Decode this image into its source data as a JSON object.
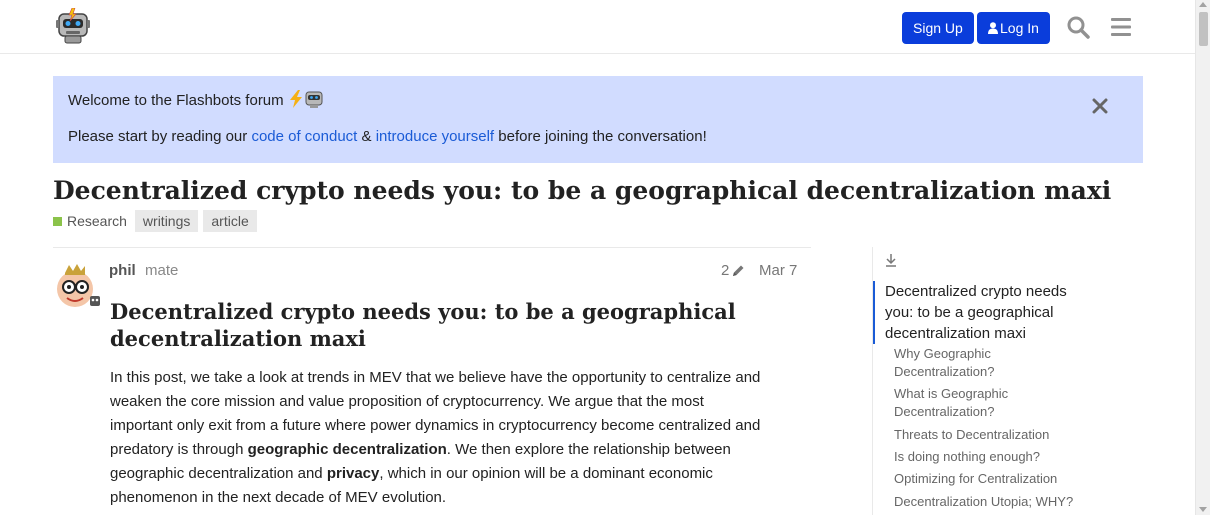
{
  "header": {
    "signup_label": "Sign Up",
    "login_label": "Log In",
    "icons": [
      "robot-logo-icon",
      "user-icon",
      "search-icon",
      "hamburger-menu-icon"
    ]
  },
  "banner": {
    "welcome_text": "Welcome to the Flashbots forum",
    "line2_before": "Please start by reading our ",
    "link_conduct": "code of conduct",
    "line2_amp": " & ",
    "link_introduce": "introduce yourself",
    "line2_after": " before joining the conversation!",
    "link_color": "#1a5bd6",
    "background_color": "#d1dcff"
  },
  "topic": {
    "title": "Decentralized crypto needs you: to be a geographical decentralization maxi",
    "category": "Research",
    "category_color": "#8bc34a",
    "tags": [
      "writings",
      "article"
    ]
  },
  "post": {
    "author": "phil",
    "user_title": "mate",
    "edit_count": "2",
    "date": "Mar 7",
    "heading": "Decentralized crypto needs you: to be a geographical decentralization maxi",
    "body_1": "In this post, we take a look at trends in MEV that we believe have the opportunity to centralize and weaken the core mission and value proposition of cryptocurrency. We argue that the most important only exit from a future where power dynamics in cryptocurrency become centralized and predatory is through ",
    "body_bold_1": "geographic decentralization",
    "body_2": ". We then explore the relationship between geographic decentralization and ",
    "body_bold_2": "privacy",
    "body_3": ", which in our opinion will be a dominant economic phenomenon in the next decade of MEV evolution."
  },
  "toc": {
    "active": "Decentralized crypto needs you: to be a geographical decentralization maxi",
    "items": [
      "Why Geographic Decentralization?",
      "What is Geographic Decentralization?",
      "Threats to Decentralization",
      "Is doing nothing enough?",
      "Optimizing for Centralization",
      "Decentralization Utopia; WHY?"
    ]
  },
  "colors": {
    "primary_button": "#0a3ddb",
    "toc_active_border": "#1a5bd6"
  }
}
